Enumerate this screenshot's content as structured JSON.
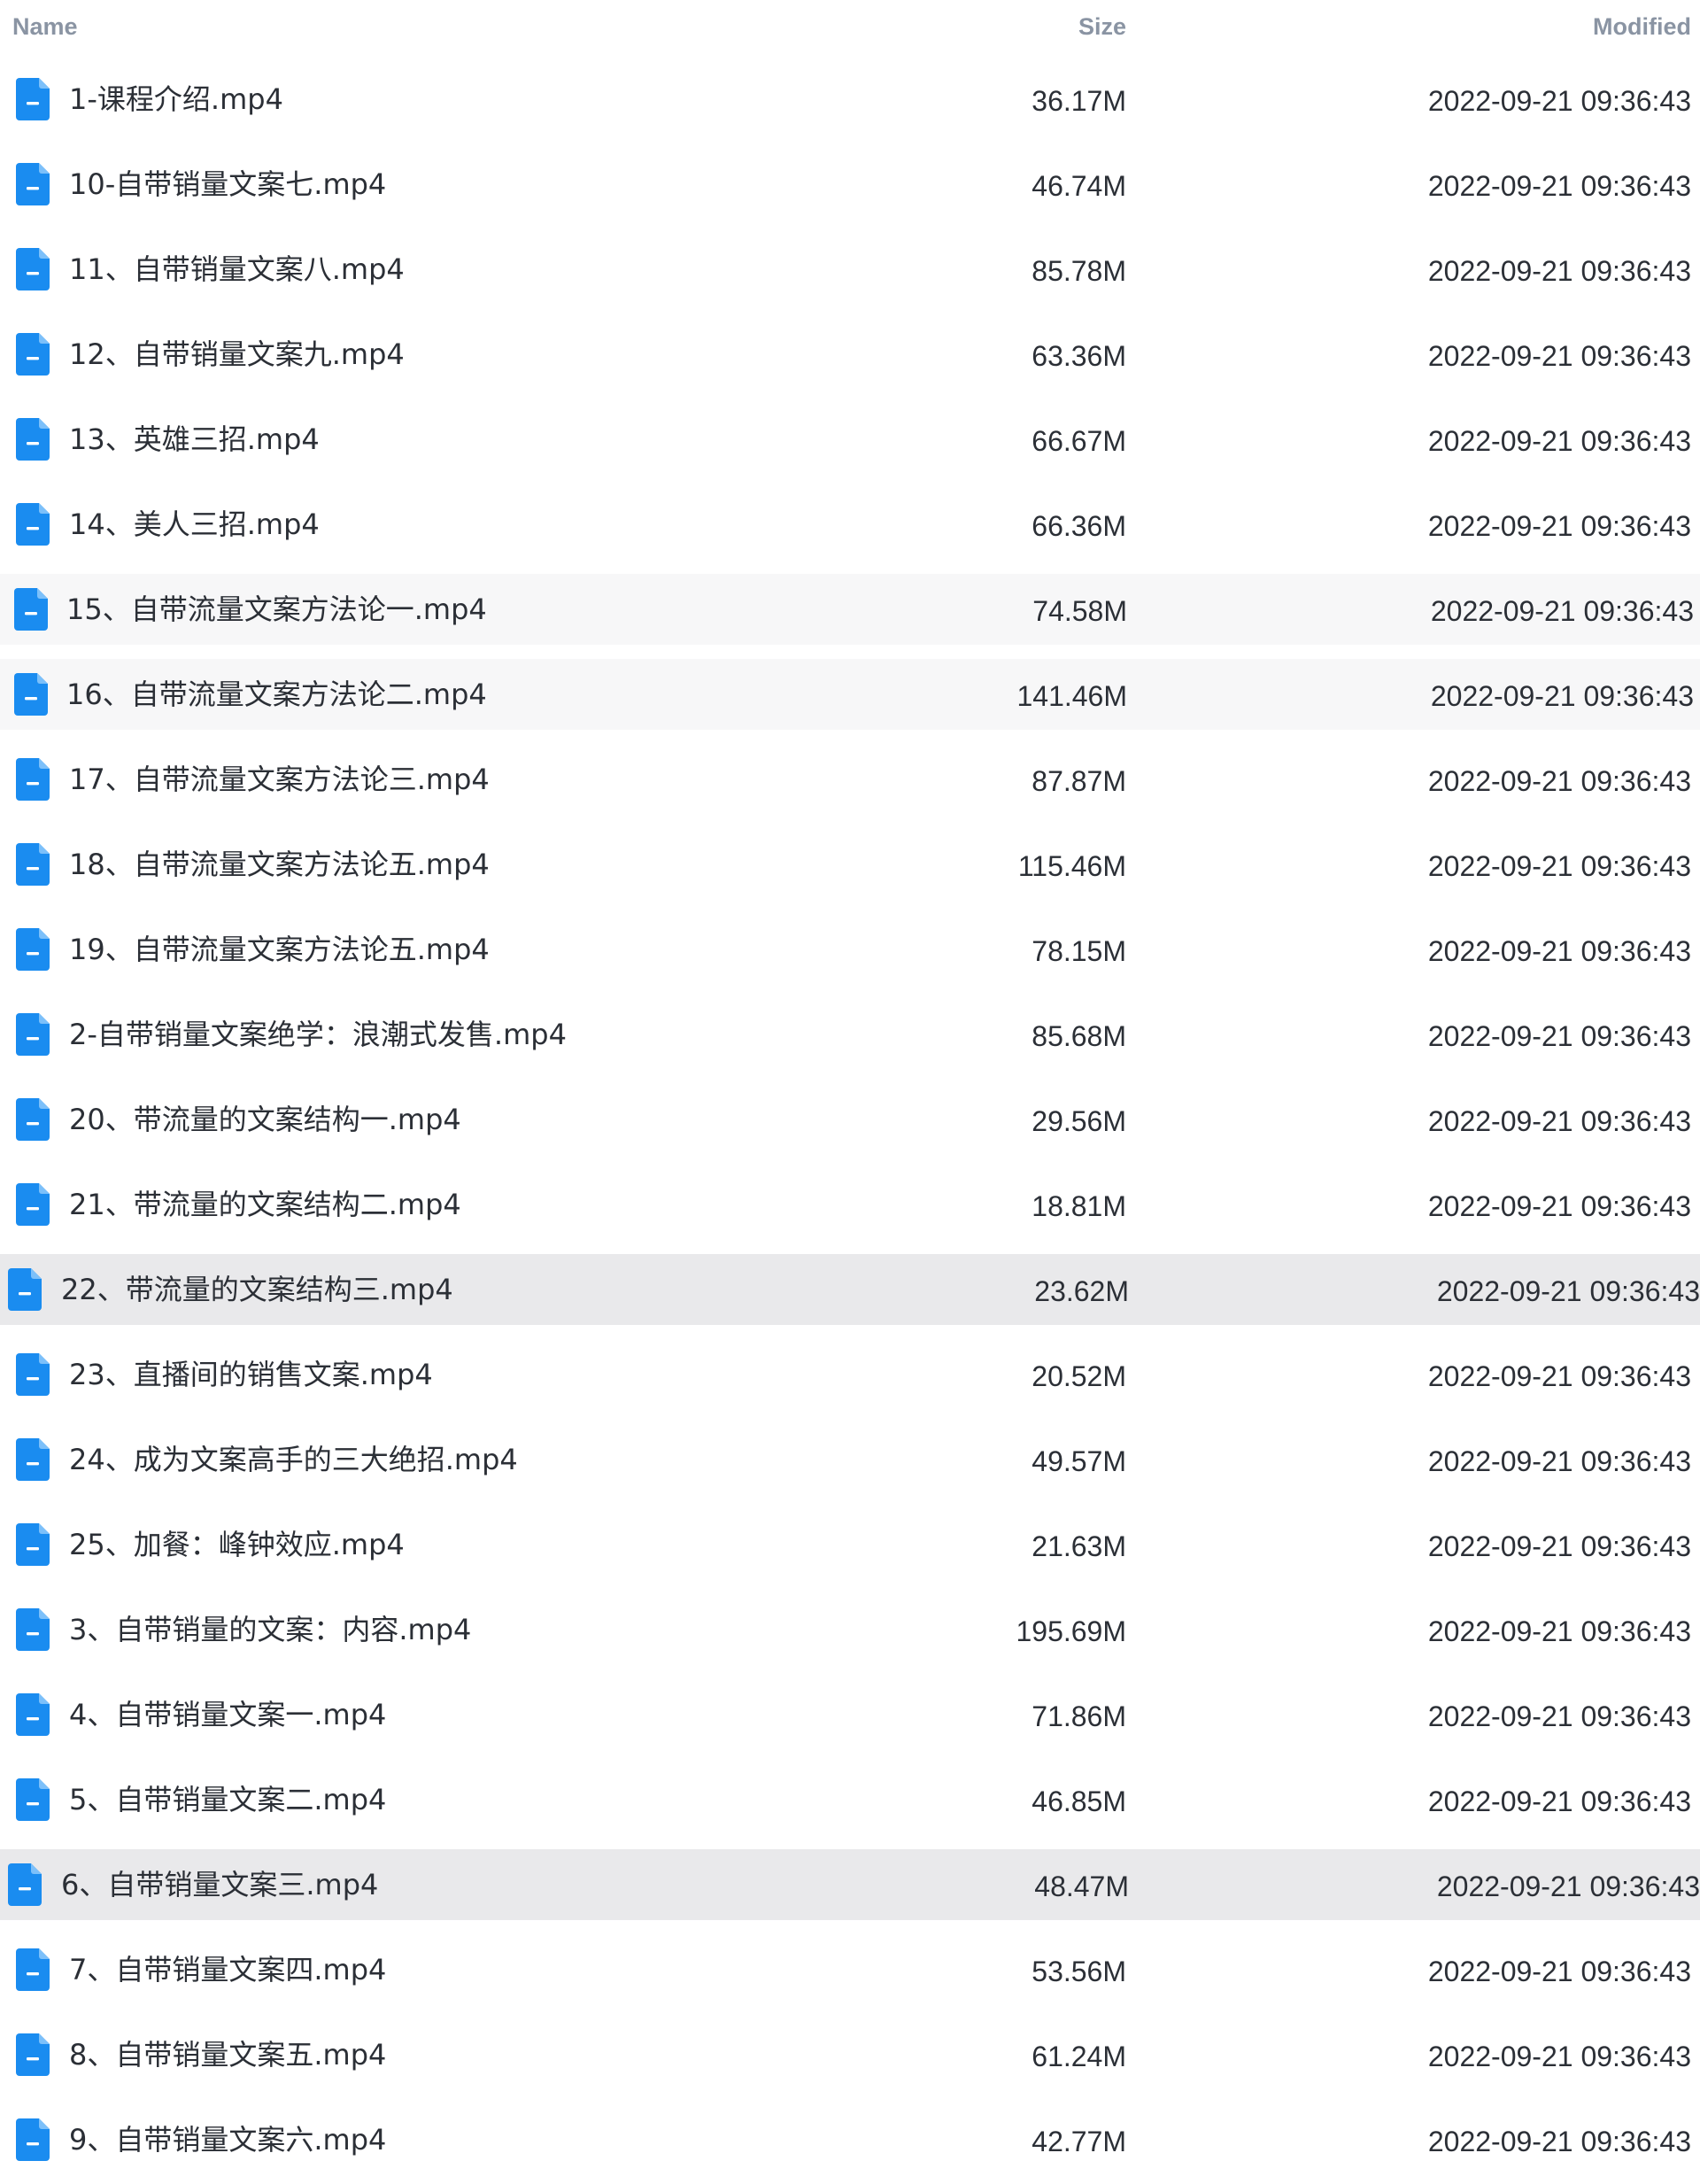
{
  "columns": {
    "name": "Name",
    "size": "Size",
    "modified": "Modified"
  },
  "colors": {
    "icon_blue": "#1a8cf0",
    "header_text": "#8a94a3",
    "row_text": "#2b2f36",
    "hover_bg": "#f7f7f8",
    "selected_bg": "#e9e9eb"
  },
  "icons": {
    "file": "video-file-icon"
  },
  "files": [
    {
      "name": "1-课程介绍.mp4",
      "size": "36.17M",
      "modified": "2022-09-21 09:36:43",
      "state": ""
    },
    {
      "name": "10-自带销量文案七.mp4",
      "size": "46.74M",
      "modified": "2022-09-21 09:36:43",
      "state": ""
    },
    {
      "name": "11、自带销量文案八.mp4",
      "size": "85.78M",
      "modified": "2022-09-21 09:36:43",
      "state": ""
    },
    {
      "name": "12、自带销量文案九.mp4",
      "size": "63.36M",
      "modified": "2022-09-21 09:36:43",
      "state": ""
    },
    {
      "name": "13、英雄三招.mp4",
      "size": "66.67M",
      "modified": "2022-09-21 09:36:43",
      "state": ""
    },
    {
      "name": "14、美人三招.mp4",
      "size": "66.36M",
      "modified": "2022-09-21 09:36:43",
      "state": ""
    },
    {
      "name": "15、自带流量文案方法论一.mp4",
      "size": "74.58M",
      "modified": "2022-09-21 09:36:43",
      "state": "hover"
    },
    {
      "name": "16、自带流量文案方法论二.mp4",
      "size": "141.46M",
      "modified": "2022-09-21 09:36:43",
      "state": "hover"
    },
    {
      "name": "17、自带流量文案方法论三.mp4",
      "size": "87.87M",
      "modified": "2022-09-21 09:36:43",
      "state": ""
    },
    {
      "name": "18、自带流量文案方法论五.mp4",
      "size": "115.46M",
      "modified": "2022-09-21 09:36:43",
      "state": ""
    },
    {
      "name": "19、自带流量文案方法论五.mp4",
      "size": "78.15M",
      "modified": "2022-09-21 09:36:43",
      "state": ""
    },
    {
      "name": "2-自带销量文案绝学：浪潮式发售.mp4",
      "size": "85.68M",
      "modified": "2022-09-21 09:36:43",
      "state": ""
    },
    {
      "name": "20、带流量的文案结构一.mp4",
      "size": "29.56M",
      "modified": "2022-09-21 09:36:43",
      "state": ""
    },
    {
      "name": "21、带流量的文案结构二.mp4",
      "size": "18.81M",
      "modified": "2022-09-21 09:36:43",
      "state": ""
    },
    {
      "name": "22、带流量的文案结构三.mp4",
      "size": "23.62M",
      "modified": "2022-09-21 09:36:43",
      "state": "selected"
    },
    {
      "name": "23、直播间的销售文案.mp4",
      "size": "20.52M",
      "modified": "2022-09-21 09:36:43",
      "state": ""
    },
    {
      "name": "24、成为文案高手的三大绝招.mp4",
      "size": "49.57M",
      "modified": "2022-09-21 09:36:43",
      "state": ""
    },
    {
      "name": "25、加餐：峰钟效应.mp4",
      "size": "21.63M",
      "modified": "2022-09-21 09:36:43",
      "state": ""
    },
    {
      "name": "3、自带销量的文案：内容.mp4",
      "size": "195.69M",
      "modified": "2022-09-21 09:36:43",
      "state": ""
    },
    {
      "name": "4、自带销量文案一.mp4",
      "size": "71.86M",
      "modified": "2022-09-21 09:36:43",
      "state": ""
    },
    {
      "name": "5、自带销量文案二.mp4",
      "size": "46.85M",
      "modified": "2022-09-21 09:36:43",
      "state": ""
    },
    {
      "name": "6、自带销量文案三.mp4",
      "size": "48.47M",
      "modified": "2022-09-21 09:36:43",
      "state": "selected"
    },
    {
      "name": "7、自带销量文案四.mp4",
      "size": "53.56M",
      "modified": "2022-09-21 09:36:43",
      "state": ""
    },
    {
      "name": "8、自带销量文案五.mp4",
      "size": "61.24M",
      "modified": "2022-09-21 09:36:43",
      "state": ""
    },
    {
      "name": "9、自带销量文案六.mp4",
      "size": "42.77M",
      "modified": "2022-09-21 09:36:43",
      "state": ""
    }
  ]
}
